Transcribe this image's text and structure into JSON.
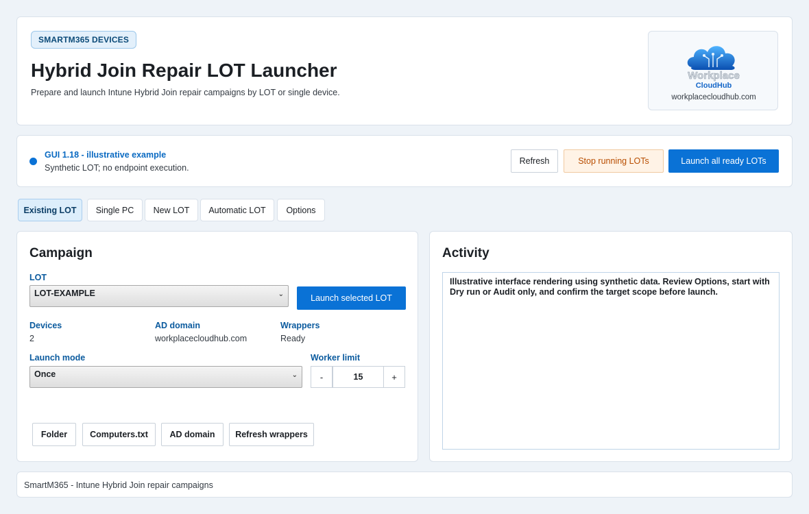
{
  "header": {
    "badge": "SMARTM365 DEVICES",
    "title": "Hybrid Join Repair LOT Launcher",
    "subtitle": "Prepare and launch Intune Hybrid Join repair campaigns by LOT or single device.",
    "logo_text_line1": "Workplace",
    "logo_text_line2": "CloudHub",
    "logo_url": "workplacecloudhub.com"
  },
  "status": {
    "title": "GUI 1.18 - illustrative example",
    "subtitle": "Synthetic LOT; no endpoint execution.",
    "dot_color": "#0a72d6",
    "refresh_label": "Refresh",
    "stop_label": "Stop running LOTs",
    "launch_all_label": "Launch all ready LOTs"
  },
  "tabs": [
    {
      "label": "Existing LOT",
      "active": true
    },
    {
      "label": "Single PC",
      "active": false
    },
    {
      "label": "New LOT",
      "active": false
    },
    {
      "label": "Automatic LOT",
      "active": false
    },
    {
      "label": "Options",
      "active": false
    }
  ],
  "campaign": {
    "title": "Campaign",
    "lot_label": "LOT",
    "lot_value": "LOT-EXAMPLE",
    "launch_selected_label": "Launch selected LOT",
    "devices_label": "Devices",
    "devices_value": "2",
    "ad_domain_label": "AD domain",
    "ad_domain_value": "workplacecloudhub.com",
    "wrappers_label": "Wrappers",
    "wrappers_value": "Ready",
    "launch_mode_label": "Launch mode",
    "launch_mode_value": "Once",
    "worker_limit_label": "Worker limit",
    "worker_limit_value": "15",
    "minus": "-",
    "plus": "+",
    "buttons": {
      "folder": "Folder",
      "computers": "Computers.txt",
      "ad_domain": "AD domain",
      "refresh_wrappers": "Refresh wrappers"
    }
  },
  "activity": {
    "title": "Activity",
    "log": "Illustrative interface rendering using synthetic data. Review Options, start with Dry run or Audit only, and confirm the target scope before launch."
  },
  "footer": {
    "text": "SmartM365 - Intune Hybrid Join repair campaigns"
  },
  "colors": {
    "accent": "#0a72d6",
    "label_blue": "#0a5a9e",
    "warning_bg": "#fff3e6",
    "warning_text": "#b84d00"
  }
}
